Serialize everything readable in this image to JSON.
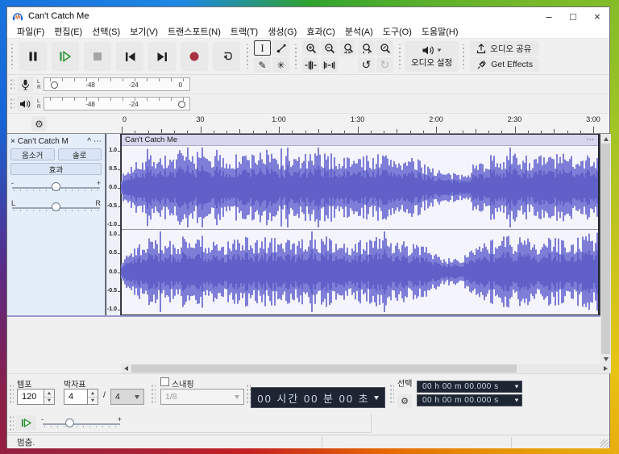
{
  "window": {
    "title": "Can't Catch Me",
    "minimize": "–",
    "maximize": "□",
    "close": "×"
  },
  "menu": {
    "items": [
      "파일(F)",
      "편집(E)",
      "선택(S)",
      "보기(V)",
      "트랜스포트(N)",
      "트랙(T)",
      "생성(G)",
      "효과(C)",
      "분석(A)",
      "도구(O)",
      "도움말(H)"
    ]
  },
  "icons": {
    "gear": "⚙",
    "undo": "↺",
    "redo": "↻",
    "pencil": "✎",
    "multi_tool": "✳",
    "ibeam": "I",
    "dots": "⋯",
    "collapse": "^",
    "close": "×"
  },
  "toolbar": {
    "audio_setup_label": "오디오 설정",
    "share_audio_label": "오디오 공유",
    "get_effects_label": "Get Effects"
  },
  "meters": {
    "record": {
      "channels": [
        "L",
        "R"
      ],
      "scale_labels": [
        "-48",
        "-24",
        "0"
      ],
      "scale_fracs": [
        0.3,
        0.62,
        0.965
      ]
    },
    "play": {
      "channels": [
        "L",
        "R"
      ],
      "scale_labels": [
        "-48",
        "-24"
      ],
      "scale_fracs": [
        0.3,
        0.62
      ]
    }
  },
  "timeline": {
    "major_labels": [
      "0",
      "30",
      "1:00",
      "1:30",
      "2:00",
      "2:30",
      "3:00"
    ]
  },
  "track": {
    "name": "Can't Catch M",
    "clip_title": "Can't Catch Me",
    "mute_label": "음소거",
    "solo_label": "솔로",
    "effects_label": "효과",
    "gain_min": "-",
    "gain_max": "+",
    "pan_left": "L",
    "pan_right": "R",
    "ruler_values": [
      "1.0",
      "0.5",
      "0.0",
      "-0.5",
      "-1.0"
    ]
  },
  "waveform": {
    "color_peak": "#7e7ed8",
    "color_rms": "#6060c8",
    "background": "#f4f4fc",
    "seed": 7,
    "envelope": [
      0.3,
      0.75,
      0.9,
      0.82,
      0.88,
      0.92,
      0.85,
      0.8,
      0.88,
      0.92,
      0.86,
      0.8,
      0.86,
      0.9,
      0.84,
      0.78,
      0.84,
      0.88,
      0.8,
      0.74,
      0.62,
      0.4,
      0.34,
      0.6,
      0.84,
      0.9,
      0.86,
      0.8,
      0.88,
      0.84,
      0.9,
      0.87
    ]
  },
  "bottom": {
    "tempo_label": "템포",
    "tempo_value": "120",
    "timesig_label": "박자표",
    "timesig_upper": "4",
    "timesig_divider": "/",
    "timesig_lower": "4",
    "snapping_label": "스내핑",
    "snap_value": "1/8",
    "time_display": "00 시간 00 분 00 초",
    "selection_label": "선택",
    "selection_start": "00 h 00 m 00.000 s",
    "selection_end": "00 h 00 m 00.000 s"
  },
  "status": {
    "text": "멈춤."
  }
}
